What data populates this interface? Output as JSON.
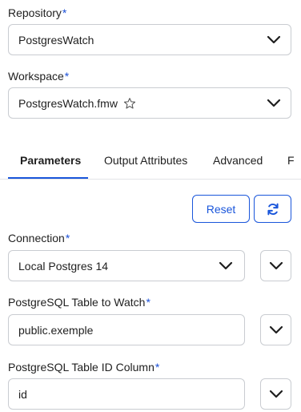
{
  "repository": {
    "label": "Repository",
    "required_mark": "*",
    "value": "PostgresWatch"
  },
  "workspace": {
    "label": "Workspace",
    "required_mark": "*",
    "value": "PostgresWatch.fmw"
  },
  "tabs": [
    {
      "label": "Parameters"
    },
    {
      "label": "Output Attributes"
    },
    {
      "label": "Advanced"
    },
    {
      "label": "F"
    }
  ],
  "actions": {
    "reset_label": "Reset"
  },
  "connection": {
    "label": "Connection",
    "required_mark": "*",
    "value": "Local Postgres 14"
  },
  "table_to_watch": {
    "label": "PostgreSQL Table to Watch",
    "required_mark": "*",
    "value": "public.exemple"
  },
  "table_id_column": {
    "label": "PostgreSQL Table ID Column",
    "required_mark": "*",
    "value": "id"
  },
  "colors": {
    "accent": "#1a56db",
    "required": "#1a4fd6",
    "border": "#c9ccd1"
  }
}
